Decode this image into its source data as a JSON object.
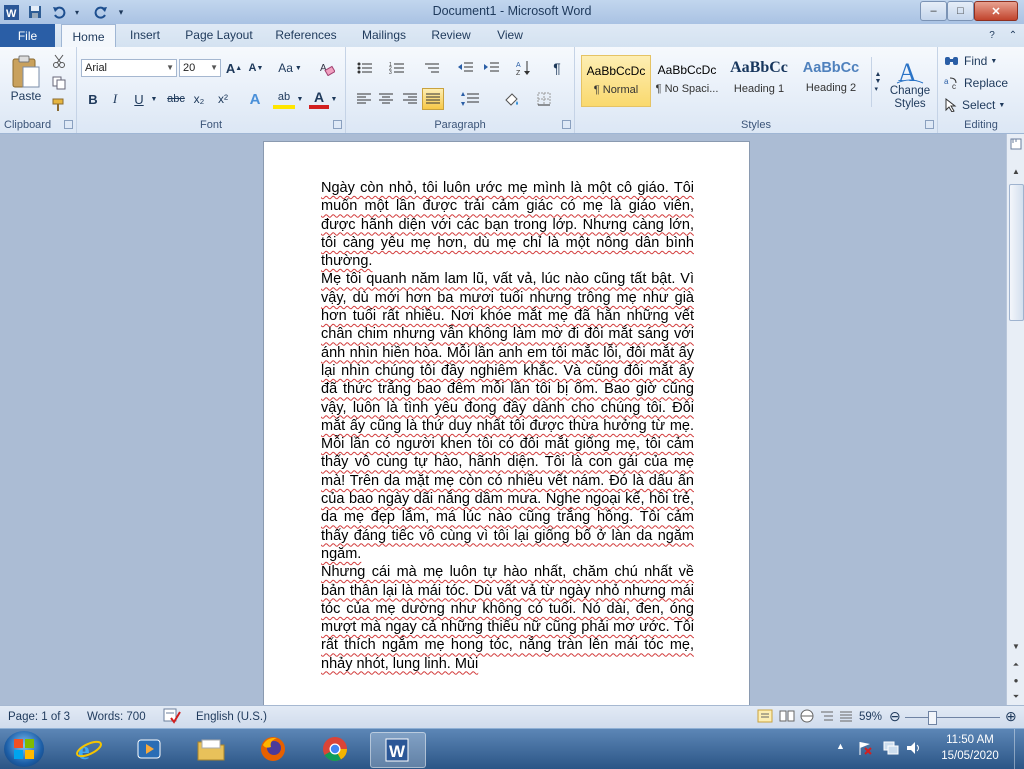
{
  "window": {
    "title": "Document1 - Microsoft Word",
    "controls": {
      "minimize": "‒",
      "maximize": "□",
      "close": "✕"
    }
  },
  "quick_access": {
    "app_icon": "word-icon",
    "save": "save-icon",
    "undo": "undo-icon",
    "redo": "redo-icon"
  },
  "tabs": {
    "file": "File",
    "items": [
      "Home",
      "Insert",
      "Page Layout",
      "References",
      "Mailings",
      "Review",
      "View"
    ],
    "active": "Home"
  },
  "ribbon": {
    "clipboard": {
      "label": "Clipboard",
      "paste": "Paste"
    },
    "font": {
      "label": "Font",
      "name": "Arial",
      "size": "20",
      "grow": "A",
      "shrink": "A",
      "case": "Aa",
      "bold": "B",
      "italic": "I",
      "underline": "U",
      "strike": "abc",
      "subscript": "x₂",
      "superscript": "x²",
      "effects": "A",
      "highlight": "ab",
      "color": "A",
      "color_hex": "#d22020"
    },
    "paragraph": {
      "label": "Paragraph",
      "show_marks": "¶"
    },
    "styles": {
      "label": "Styles",
      "items": [
        {
          "sample": "AaBbCcDc",
          "name": "¶ Normal"
        },
        {
          "sample": "AaBbCcDc",
          "name": "¶ No Spaci..."
        },
        {
          "sample": "AaBbCc",
          "name": "Heading 1"
        },
        {
          "sample": "AaBbCc",
          "name": "Heading 2"
        }
      ],
      "change": "Change Styles"
    },
    "editing": {
      "label": "Editing",
      "find": "Find",
      "replace": "Replace",
      "select": "Select"
    }
  },
  "document": {
    "paragraphs": [
      "Ngày còn nhỏ, tôi luôn ước mẹ mình là một cô giáo. Tôi muốn một lần được trải cảm giác có mẹ là giáo viên, được hãnh diện với các bạn trong lớp. Nhưng càng lớn, tôi càng yêu mẹ hơn, dù mẹ chỉ là một nông dân bình thường.",
      "Mẹ tôi quanh năm lam lũ, vất vả, lúc nào cũng tất bật. Vì vậy, dù mới hơn ba mươi tuổi nhưng trông mẹ như già hơn tuổi rất nhiều. Nơi khóe mắt mẹ đã hằn những vết chân chim nhưng vẫn không làm mờ đi đôi mắt sáng với ánh nhìn hiền hòa. Mỗi lần anh em tôi mắc lỗi, đôi mắt ấy lại nhìn chúng tôi đầy nghiêm khắc. Và cũng đôi mắt ấy đã thức trắng bao đêm mỗi lần tôi bị ốm. Bao giờ cũng vậy, luôn là tình yêu đong đầy dành cho chúng tôi. Đôi mắt ấy cũng là thứ duy nhất tôi được thừa hưởng từ mẹ. Mỗi lần có người khen tôi có đôi mắt giống mẹ, tôi cảm thấy vô cùng tự hào, hãnh diện. Tôi là con gái của mẹ mà! Trên da mặt mẹ còn có nhiều vết nám. Đó là dấu ấn của bao ngày dãi nắng dầm mưa. Nghe ngoại kể, hồi trẻ, da mẹ đẹp lắm, má lúc nào cũng trắng hồng. Tôi cảm thấy đáng tiếc vô cùng vì tôi lại giống bố ở làn da ngăm ngăm.",
      "Nhưng cái mà mẹ luôn tự hào nhất, chăm chú nhất về bản thân lại là mái tóc. Dù vất vả từ ngày nhỏ nhưng mái tóc của mẹ dường như không có tuổi. Nó dài, đen, óng mượt mà ngay cả những thiếu nữ cũng phải mơ ước. Tôi rất thích ngắm mẹ hong tóc, nắng tràn lên mái tóc mẹ, nhảy nhót, lung linh. Mùi"
    ]
  },
  "statusbar": {
    "page": "Page: 1 of 3",
    "words": "Words: 700",
    "language": "English (U.S.)",
    "zoom": "59%",
    "zoom_level": 0.59
  },
  "taskbar": {
    "apps": [
      "internet-explorer-icon",
      "media-player-icon",
      "file-explorer-icon",
      "firefox-icon",
      "chrome-icon",
      "word-icon"
    ],
    "time": "11:50 AM",
    "date": "15/05/2020"
  },
  "colors": {
    "file_tab": "#2a5ea6",
    "selected_style": "#fad96e",
    "spell_underline": "#d23b3b"
  }
}
